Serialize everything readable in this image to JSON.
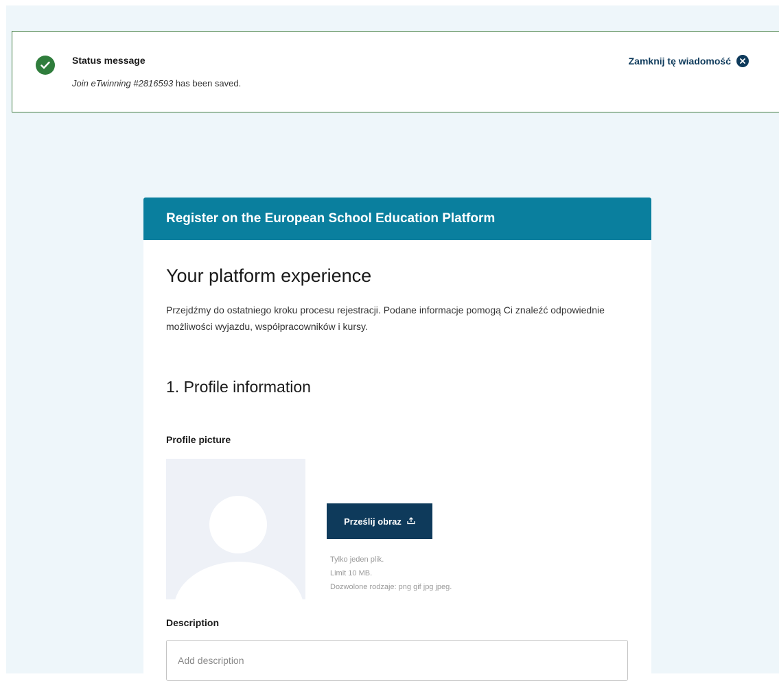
{
  "status": {
    "title": "Status message",
    "message_italic": "Join eTwinning #2816593",
    "message_rest": " has been saved.",
    "close_label": "Zamknij tę wiadomość"
  },
  "card": {
    "header": "Register on the European School Education Platform",
    "heading": "Your platform experience",
    "intro": "Przejdźmy do ostatniego kroku procesu rejestracji. Podane informacje pomogą Ci znaleźć odpowiednie możliwości wyjazdu, współpracowników i kursy.",
    "section_title": "1. Profile information",
    "profile_picture_label": "Profile picture",
    "upload_button": "Prześlij obraz",
    "hints": [
      "Tylko jeden plik.",
      "Limit 10 MB.",
      "Dozwolone rodzaje: png gif jpg jpeg."
    ],
    "description_label": "Description",
    "description_placeholder": "Add description"
  },
  "colors": {
    "success_green": "#2f7d3c",
    "header_teal": "#0a7f9e",
    "primary_navy": "#0e3a5b",
    "page_background": "#eef6fa"
  },
  "icons": {
    "status": "check-circle-icon",
    "close": "close-circle-icon",
    "upload": "upload-icon"
  }
}
